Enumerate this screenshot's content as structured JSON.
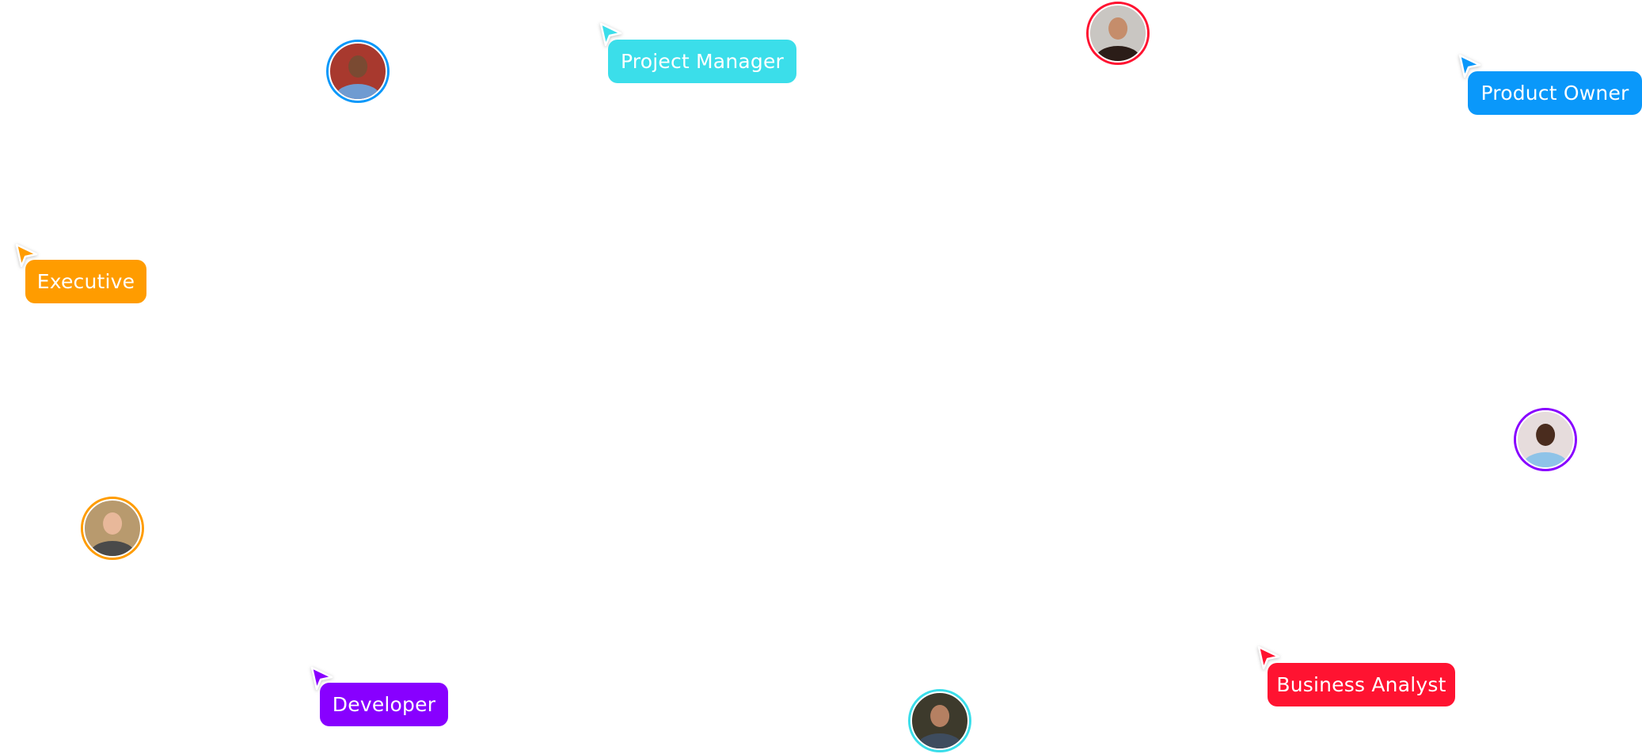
{
  "roles": [
    {
      "id": "project-manager",
      "label": "Project Manager",
      "color": "#3bdeea"
    },
    {
      "id": "product-owner",
      "label": "Product Owner",
      "color": "#0a98fa"
    },
    {
      "id": "executive",
      "label": "Executive",
      "color": "#ff9c00"
    },
    {
      "id": "developer",
      "label": "Developer",
      "color": "#8800ff"
    },
    {
      "id": "business-analyst",
      "label": "Business Analyst",
      "color": "#ff1331"
    }
  ],
  "avatars": [
    {
      "name": "avatar-blue",
      "icon": "person-photo",
      "ring_color": "#0a98fa",
      "bg": "#a8392e",
      "skin": "#7a4a32",
      "shirt": "#6f9bd1"
    },
    {
      "name": "avatar-red",
      "icon": "person-photo",
      "ring_color": "#ff1331",
      "bg": "#c9c6c2",
      "skin": "#c58d6b",
      "shirt": "#2b1d18"
    },
    {
      "name": "avatar-purple",
      "icon": "person-photo",
      "ring_color": "#8800ff",
      "bg": "#e6dcdc",
      "skin": "#4a2c1e",
      "shirt": "#8ec3e8"
    },
    {
      "name": "avatar-orange",
      "icon": "person-photo",
      "ring_color": "#ff9c00",
      "bg": "#b89a6e",
      "skin": "#e8b89a",
      "shirt": "#4a4a4a"
    },
    {
      "name": "avatar-cyan",
      "icon": "person-photo",
      "ring_color": "#3bdeea",
      "bg": "#3d3a2c",
      "skin": "#b58062",
      "shirt": "#3e4c5e"
    }
  ]
}
